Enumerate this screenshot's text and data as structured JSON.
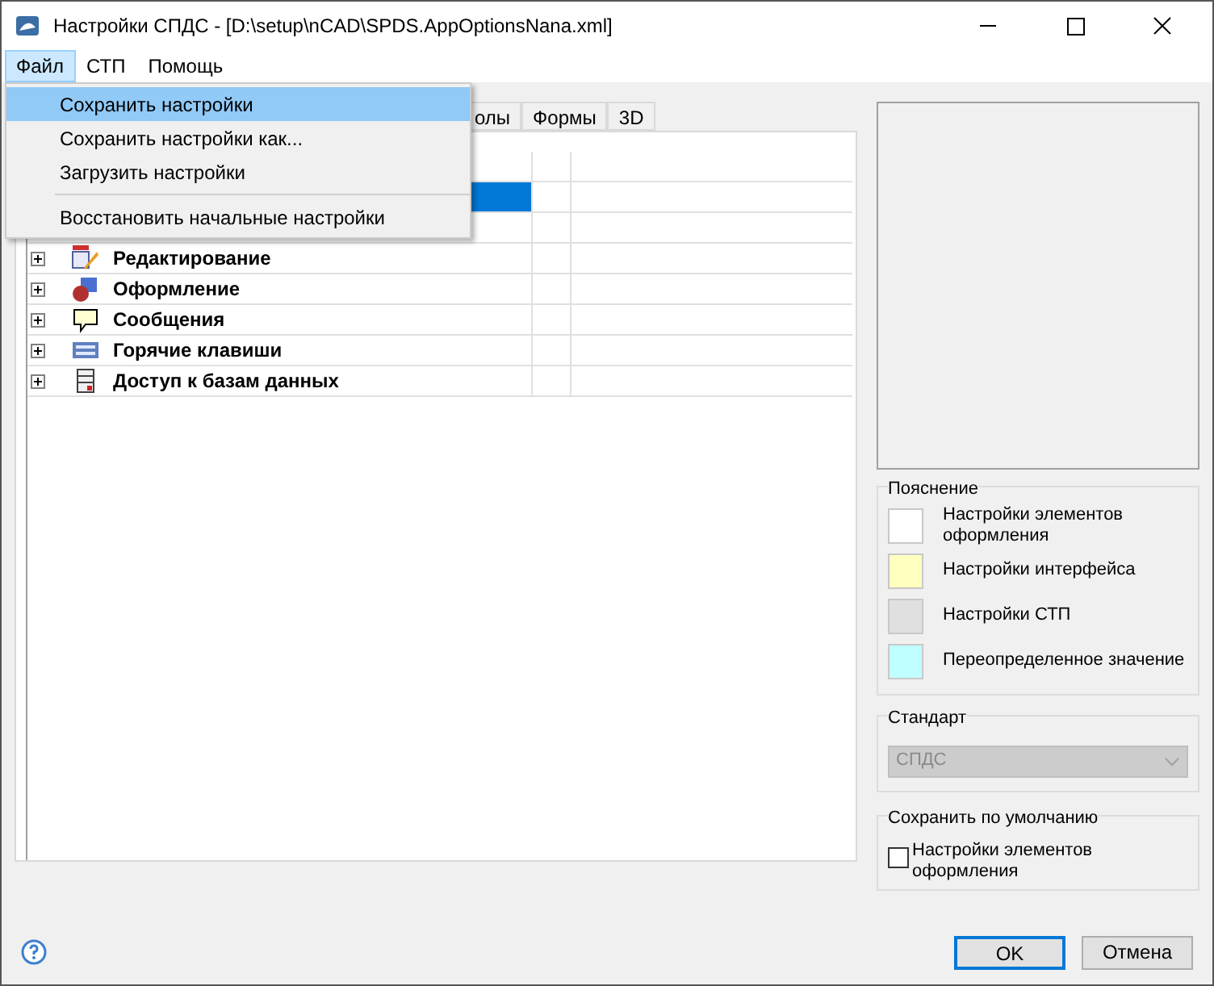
{
  "window": {
    "title": "Настройки СПДС - [D:\\setup\\nCAD\\SPDS.AppOptionsNana.xml]"
  },
  "menu_bar": [
    {
      "label": "Файл",
      "selected": true
    },
    {
      "label": "СТП",
      "selected": false
    },
    {
      "label": "Помощь",
      "selected": false
    }
  ],
  "open_menu": [
    {
      "label": "Сохранить настройки",
      "selected": true,
      "kind": "item"
    },
    {
      "label": "Сохранить настройки как...",
      "selected": false,
      "kind": "item"
    },
    {
      "label": "Загрузить настройки",
      "selected": false,
      "kind": "item"
    },
    {
      "kind": "separator"
    },
    {
      "label": "Восстановить начальные настройки",
      "selected": false,
      "kind": "item"
    }
  ],
  "tabs": [
    {
      "label": "олы",
      "selected": false
    },
    {
      "label": "Формы",
      "selected": false
    },
    {
      "label": "3D",
      "selected": false
    }
  ],
  "tree": [
    {
      "selected": false
    },
    {
      "selected": true
    },
    {
      "selected": false
    },
    {
      "label": "Редактирование",
      "selected": false
    },
    {
      "label": "Оформление",
      "selected": false
    },
    {
      "label": "Сообщения",
      "selected": false
    },
    {
      "label": "Горячие клавиши",
      "selected": false
    },
    {
      "label": "Доступ к базам данных",
      "selected": false
    }
  ],
  "legend": {
    "title": "Пояснение",
    "items": [
      {
        "label": "Настройки элементов оформления",
        "color": "#ffffff"
      },
      {
        "label": "Настройки интерфейса",
        "color": "#ffffc0"
      },
      {
        "label": "Настройки СТП",
        "color": "#e0e0e0"
      },
      {
        "label": "Переопределенное значение",
        "color": "#c0ffff"
      }
    ]
  },
  "standard": {
    "title": "Стандарт",
    "value": "СПДС",
    "disabled": true
  },
  "save_default": {
    "title": "Сохранить по умолчанию",
    "checkbox": {
      "label": "Настройки элементов оформления",
      "checked": false
    }
  },
  "buttons": [
    {
      "label": "OK",
      "default": true
    },
    {
      "label": "Отмена",
      "default": false
    }
  ]
}
